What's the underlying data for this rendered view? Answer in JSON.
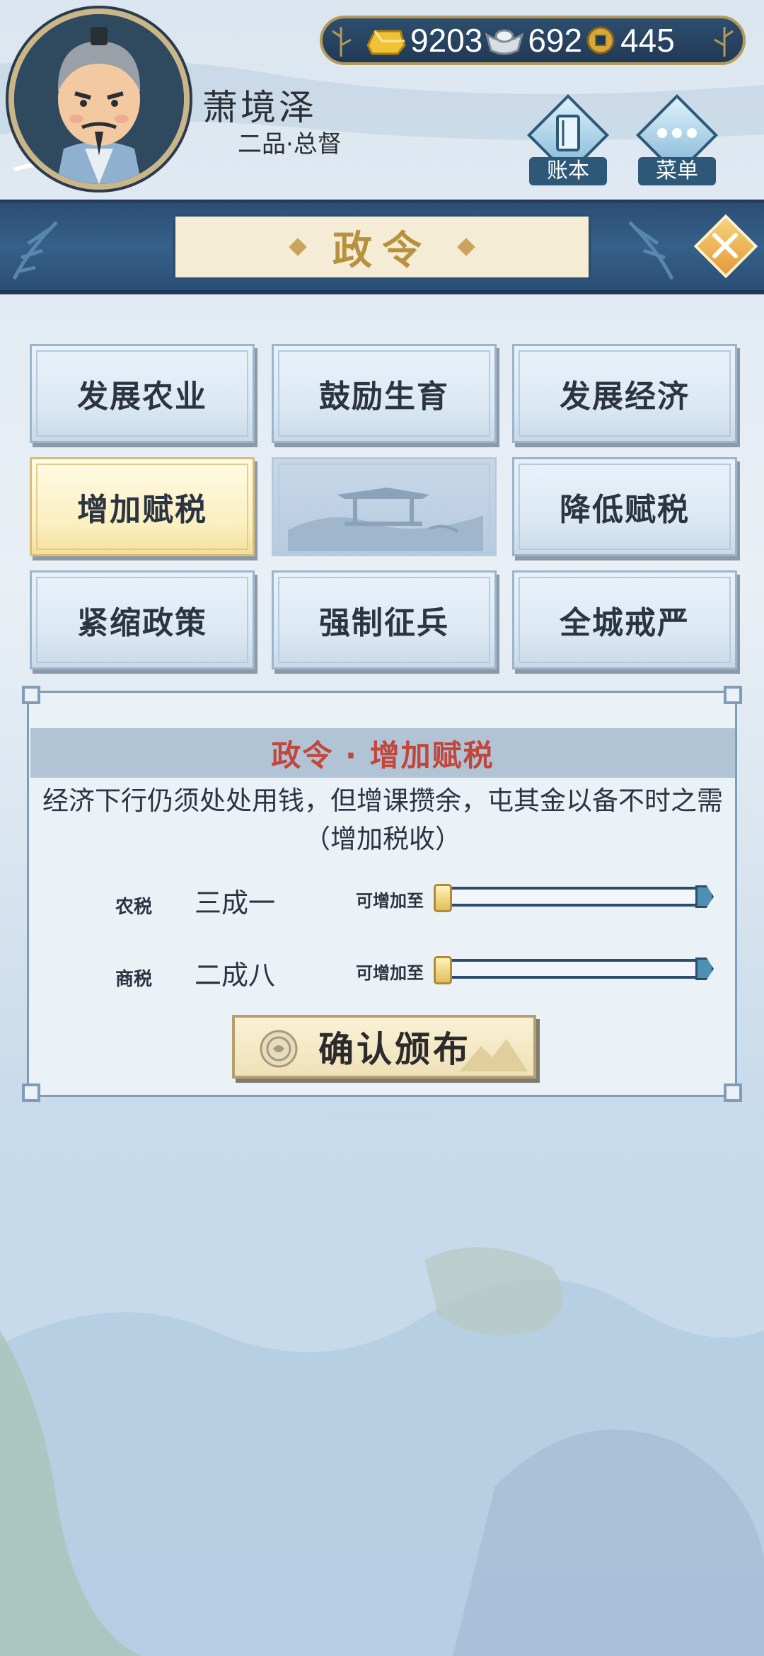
{
  "player": {
    "name": "萧境泽",
    "rank": "二品·总督"
  },
  "currency": [
    {
      "icon": "gold-ingot-icon",
      "value": "9203"
    },
    {
      "icon": "silver-ingot-icon",
      "value": "692"
    },
    {
      "icon": "copper-coin-icon",
      "value": "445"
    }
  ],
  "nav": {
    "ledger_label": "账本",
    "menu_label": "菜单"
  },
  "page": {
    "title": "政令"
  },
  "policies": [
    {
      "label": "发展农业",
      "state": "normal"
    },
    {
      "label": "鼓励生育",
      "state": "normal"
    },
    {
      "label": "发展经济",
      "state": "normal"
    },
    {
      "label": "增加赋税",
      "state": "selected"
    },
    {
      "label": "",
      "state": "locked"
    },
    {
      "label": "降低赋税",
      "state": "normal"
    },
    {
      "label": "紧缩政策",
      "state": "normal"
    },
    {
      "label": "强制征兵",
      "state": "normal"
    },
    {
      "label": "全城戒严",
      "state": "normal"
    }
  ],
  "detail": {
    "title": "政令 · 增加赋税",
    "description": "经济下行仍须处处用钱，但增课攒余，屯其金以备不时之需（增加税收）",
    "taxes": [
      {
        "name": "农税",
        "value": "三成一",
        "limit_label": "可增加至",
        "slider_fraction": 0
      },
      {
        "name": "商税",
        "value": "二成八",
        "limit_label": "可增加至",
        "slider_fraction": 0
      }
    ],
    "confirm_label": "确认颁布"
  },
  "colors": {
    "banner": "#2c4e74",
    "accent_gold": "#b8913f",
    "title_red": "#c2463b",
    "selected_card": "#fbefbf"
  }
}
